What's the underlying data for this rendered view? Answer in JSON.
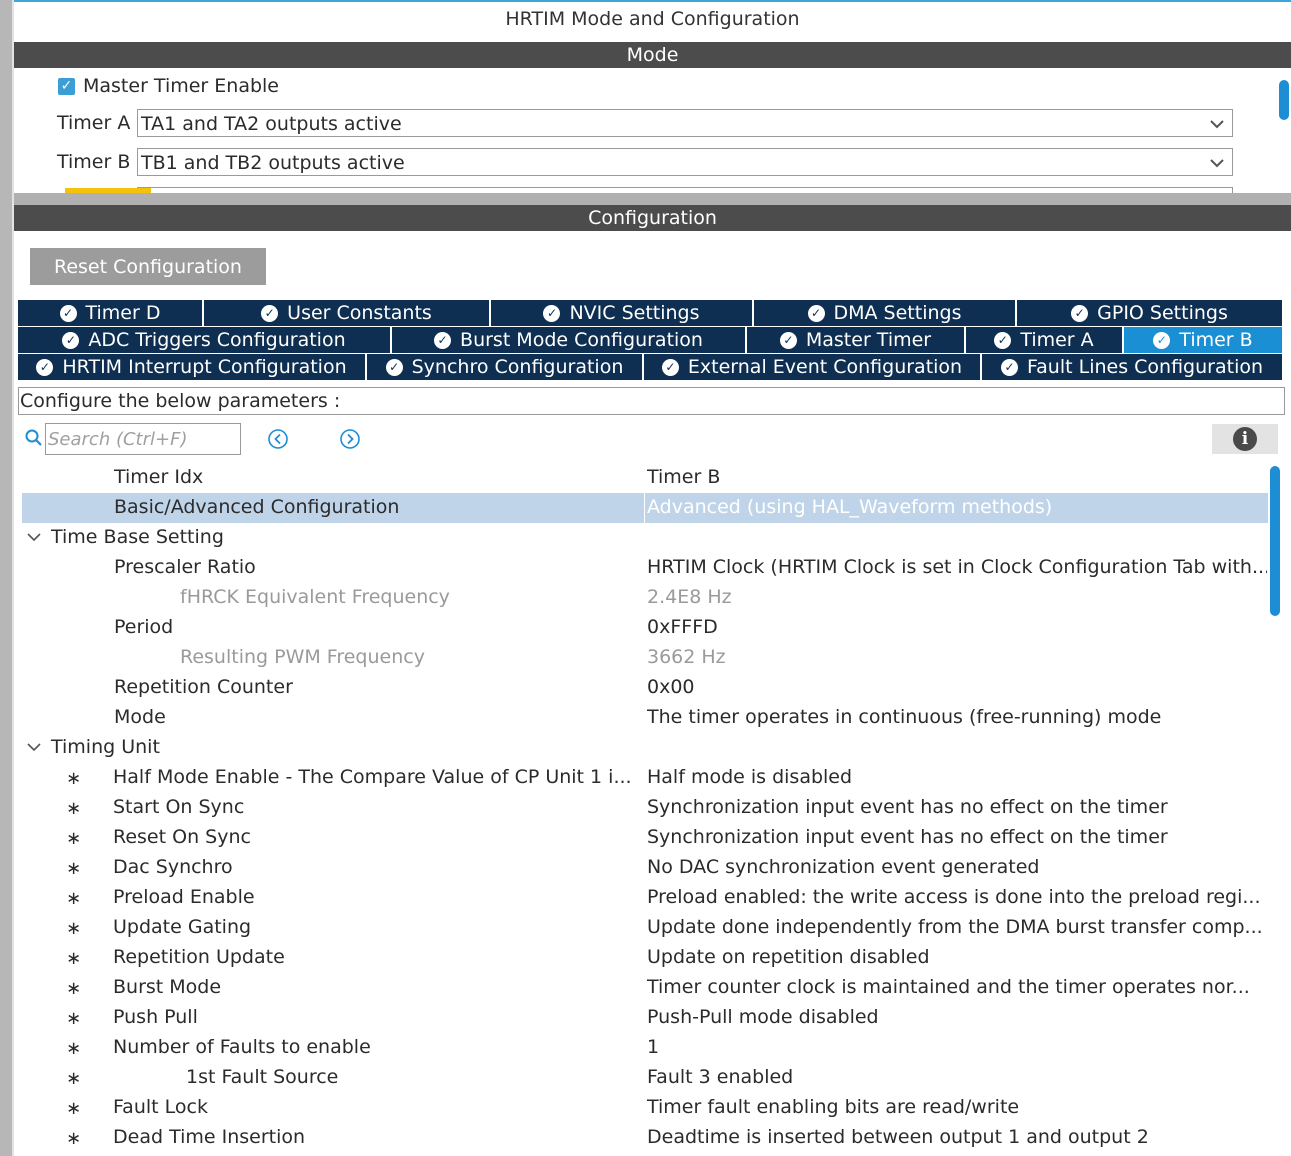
{
  "window": {
    "title": "HRTIM Mode and Configuration"
  },
  "mode": {
    "header": "Mode",
    "master_timer_enable": {
      "label": "Master Timer Enable",
      "checked": true
    },
    "rows": [
      {
        "label": "Timer A",
        "value": "TA1 and TA2 outputs active"
      },
      {
        "label": "Timer B",
        "value": "TB1 and TB2 outputs active"
      }
    ]
  },
  "config": {
    "header": "Configuration",
    "reset_label": "Reset Configuration",
    "tabs_row1": [
      "Timer D",
      "User Constants",
      "NVIC Settings",
      "DMA Settings",
      "GPIO Settings"
    ],
    "tabs_row2": [
      "ADC Triggers Configuration",
      "Burst Mode Configuration",
      "Master Timer",
      "Timer A",
      "Timer B"
    ],
    "tabs_row3": [
      "HRTIM Interrupt Configuration",
      "Synchro Configuration",
      "External Event Configuration",
      "Fault Lines Configuration"
    ],
    "active_tab": "Timer B",
    "params_text": "Configure the below parameters :",
    "search_placeholder": "Search (Ctrl+F)"
  },
  "properties": [
    {
      "name": "Timer Idx",
      "value": "Timer B"
    },
    {
      "name": "Basic/Advanced Configuration",
      "value": "Advanced (using HAL_Waveform methods)"
    },
    {
      "name": "Time Base Setting"
    },
    {
      "name": "Prescaler Ratio",
      "value": "HRTIM Clock (HRTIM Clock is set in Clock Configuration Tab with..."
    },
    {
      "name": "fHRCK Equivalent Frequency",
      "value": "2.4E8 Hz"
    },
    {
      "name": "Period",
      "value": "0xFFFD"
    },
    {
      "name": "Resulting PWM Frequency",
      "value": "3662 Hz"
    },
    {
      "name": "Repetition Counter",
      "value": "0x00"
    },
    {
      "name": "Mode",
      "value": "The timer operates in continuous (free-running) mode"
    },
    {
      "name": "Timing Unit"
    },
    {
      "name": "Half Mode Enable - The Compare Value of CP Unit 1 i...",
      "value": "Half mode is disabled"
    },
    {
      "name": "Start On Sync",
      "value": "Synchronization input event has no effect on the timer"
    },
    {
      "name": "Reset On Sync",
      "value": "Synchronization input event has no effect on the timer"
    },
    {
      "name": "Dac Synchro",
      "value": "No DAC synchronization event generated"
    },
    {
      "name": "Preload Enable",
      "value": "Preload enabled: the write access is done into the preload regi..."
    },
    {
      "name": "Update Gating",
      "value": "Update done independently from the DMA burst transfer comp..."
    },
    {
      "name": "Repetition Update",
      "value": "Update on repetition disabled"
    },
    {
      "name": "Burst Mode",
      "value": "Timer counter clock is maintained and the timer operates nor..."
    },
    {
      "name": "Push Pull",
      "value": "Push-Pull mode disabled"
    },
    {
      "name": "Number of Faults to enable",
      "value": "1"
    },
    {
      "name": "1st Fault Source",
      "value": "Fault 3 enabled"
    },
    {
      "name": "Fault Lock",
      "value": "Timer fault enabling bits are read/write"
    },
    {
      "name": "Dead Time Insertion",
      "value": "Deadtime is inserted between output 1 and output 2"
    }
  ]
}
